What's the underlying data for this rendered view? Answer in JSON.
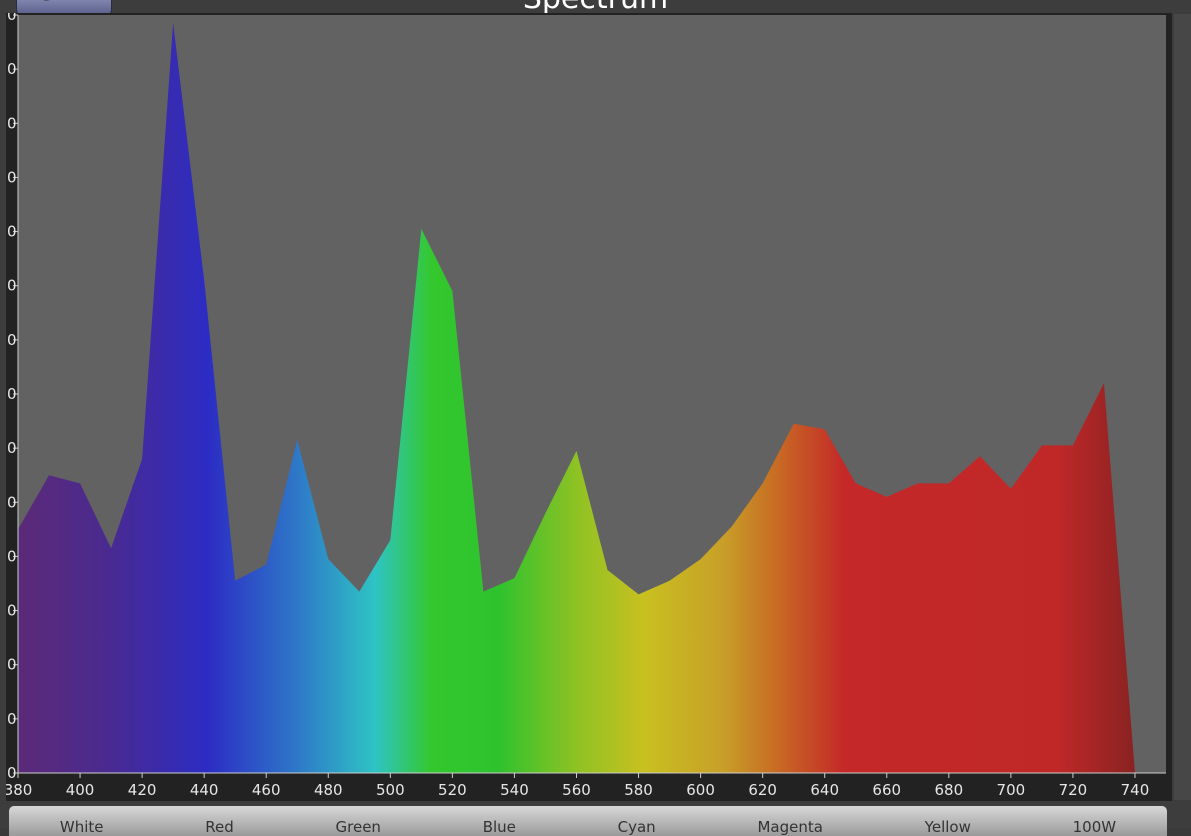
{
  "window": {
    "title": "Spectrum"
  },
  "chart_data": {
    "type": "area",
    "x": [
      380,
      390,
      400,
      410,
      420,
      430,
      440,
      450,
      460,
      470,
      480,
      490,
      500,
      510,
      520,
      530,
      540,
      550,
      560,
      570,
      580,
      590,
      600,
      610,
      620,
      630,
      640,
      650,
      660,
      670,
      680,
      690,
      700,
      710,
      720,
      730,
      740
    ],
    "values": [
      450,
      550,
      535,
      415,
      580,
      1385,
      910,
      355,
      385,
      615,
      395,
      335,
      430,
      1005,
      890,
      335,
      360,
      480,
      595,
      375,
      330,
      355,
      395,
      455,
      535,
      645,
      635,
      535,
      510,
      535,
      535,
      585,
      525,
      605,
      605,
      720,
      0
    ],
    "xlim": [
      380,
      750
    ],
    "ylim": [
      0,
      1400
    ],
    "xticks": [
      "380",
      "400",
      "420",
      "440",
      "460",
      "480",
      "500",
      "520",
      "540",
      "560",
      "580",
      "600",
      "620",
      "640",
      "660",
      "680",
      "700",
      "720",
      "740"
    ],
    "ytick_visible_suffix": [
      "0",
      "0",
      "0",
      "0",
      "0",
      "0",
      "0",
      "0",
      "0",
      "0",
      "0",
      "0",
      "0",
      "0",
      "0"
    ],
    "fill": "wavelength-gradient",
    "plot_background": "#626262",
    "grid": false
  },
  "bottom_bar": {
    "buttons": [
      "White",
      "Red",
      "Green",
      "Blue",
      "Cyan",
      "Magenta",
      "Yellow",
      "100W"
    ]
  }
}
